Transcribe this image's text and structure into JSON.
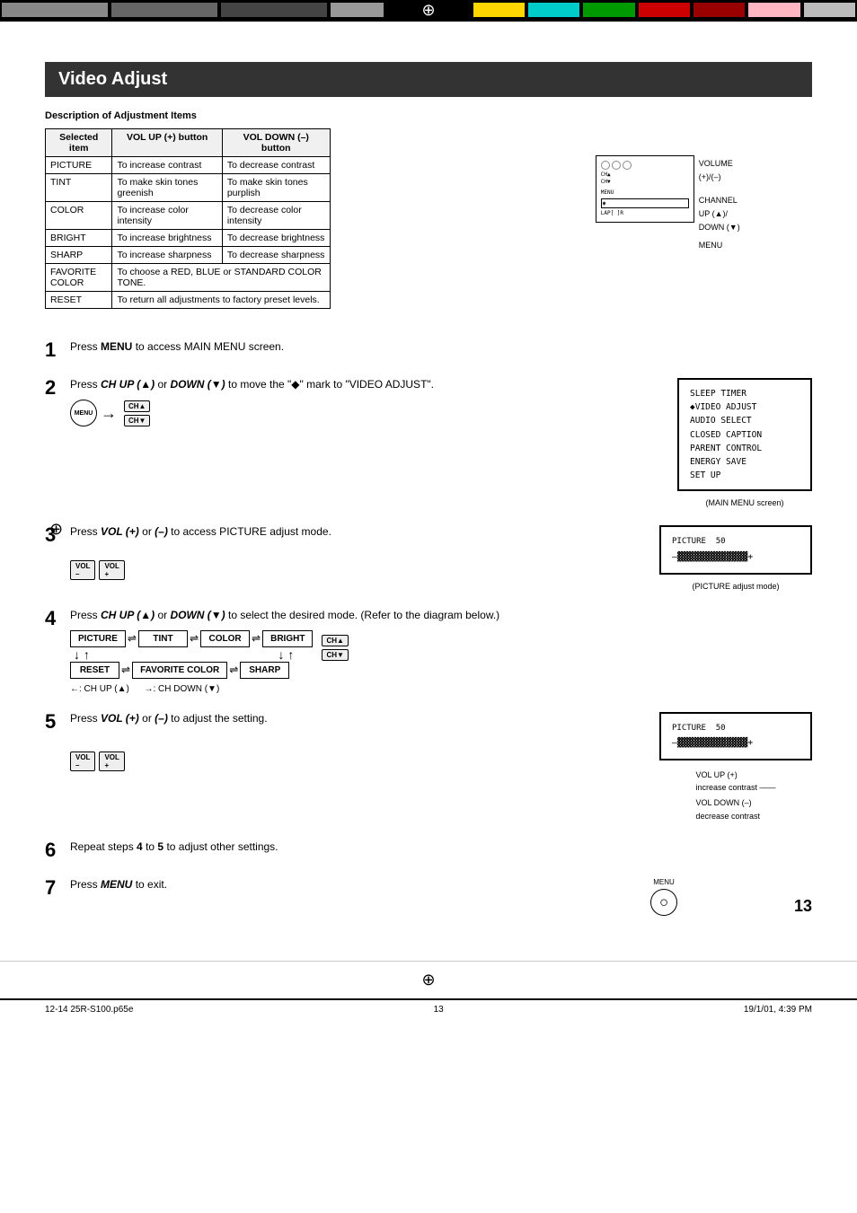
{
  "header": {
    "title": "Video Adjust",
    "crosshair": "⊕"
  },
  "top_bar_colors": [
    "#777",
    "#555",
    "#333",
    "#FFD700",
    "#00CDCD",
    "#00AA00",
    "#CC0000",
    "#AA0000",
    "#FFB6C1",
    "#BBBBBB"
  ],
  "description": {
    "header": "Description of Adjustment Items",
    "table": {
      "headers": [
        "Selected item",
        "VOL UP (+) button",
        "VOL DOWN (–) button"
      ],
      "rows": [
        [
          "PICTURE",
          "To increase contrast",
          "To decrease contrast"
        ],
        [
          "TINT",
          "To make skin tones greenish",
          "To make skin tones purplish"
        ],
        [
          "COLOR",
          "To increase color intensity",
          "To decrease color intensity"
        ],
        [
          "BRIGHT",
          "To increase brightness",
          "To decrease brightness"
        ],
        [
          "SHARP",
          "To increase sharpness",
          "To decrease sharpness"
        ],
        [
          "FAVORITE COLOR",
          "To choose a RED, BLUE or STANDARD COLOR TONE.",
          ""
        ],
        [
          "RESET",
          "To return all adjustments to factory preset levels.",
          ""
        ]
      ]
    }
  },
  "tv_labels": {
    "volume": "VOLUME\n(+)/(–)",
    "channel": "CHANNEL\nUP (▲)/\nDOWN (▼)",
    "menu": "MENU"
  },
  "main_menu_screen": {
    "items": [
      "SLEEP TIMER",
      "◆VIDEO ADJUST",
      "AUDIO SELECT",
      "CLOSED CAPTION",
      "PARENT CONTROL",
      "ENERGY SAVE",
      "SET UP"
    ],
    "caption": "(MAIN MENU screen)"
  },
  "picture_screen": {
    "label": "PICTURE  50",
    "bar": "–▓▓▓▓▓▓▓▓▓▓▓▓▓+",
    "caption": "(PICTURE adjust mode)"
  },
  "picture_screen2": {
    "label": "PICTURE  50",
    "bar": "–▓▓▓▓▓▓▓▓▓▓▓▓▓+",
    "vol_up_label": "VOL UP (+)",
    "vol_up_desc": "increase contrast",
    "vol_down_label": "VOL DOWN (–)",
    "vol_down_desc": "decrease contrast"
  },
  "steps": [
    {
      "num": "1",
      "text": "Press ",
      "bold": "MENU",
      "text2": " to access MAIN MENU screen."
    },
    {
      "num": "2",
      "text": "Press ",
      "bold": "CH UP (▲)",
      "text2": " or ",
      "bold2": "DOWN (▼)",
      "text3": " to move the \"◆\" mark to \"VIDEO ADJUST\"."
    },
    {
      "num": "3",
      "text": "Press ",
      "bold": "VOL (+)",
      "text2": " or ",
      "bold2": "(–)",
      "text3": " to access PICTURE adjust mode."
    },
    {
      "num": "4",
      "text": "Press ",
      "bold": "CH UP (▲)",
      "text2": " or ",
      "bold2": "DOWN (▼)",
      "text3": " to select the desired mode.\n(Refer to the diagram below.)"
    },
    {
      "num": "5",
      "text": "Press ",
      "bold": "VOL (+)",
      "text2": " or ",
      "bold2": "(–)",
      "text3": " to adjust the setting."
    },
    {
      "num": "6",
      "text": "Repeat steps ",
      "bold": "4",
      "text2": " to ",
      "bold2": "5",
      "text3": " to adjust other settings."
    },
    {
      "num": "7",
      "text": "Press ",
      "bold": "MENU",
      "text2": " to exit."
    }
  ],
  "mode_diagram": {
    "row1": [
      "PICTURE",
      "TINT",
      "COLOR",
      "BRIGHT"
    ],
    "row2": [
      "RESET",
      "FAVORITE COLOR",
      "SHARP"
    ],
    "legend_up": "←: CH UP (▲)",
    "legend_down": "→: CH DOWN (▼)"
  },
  "footer": {
    "left": "12-14 25R-S100.p65e",
    "center": "13",
    "right": "19/1/01, 4:39 PM"
  },
  "page_number": "13"
}
